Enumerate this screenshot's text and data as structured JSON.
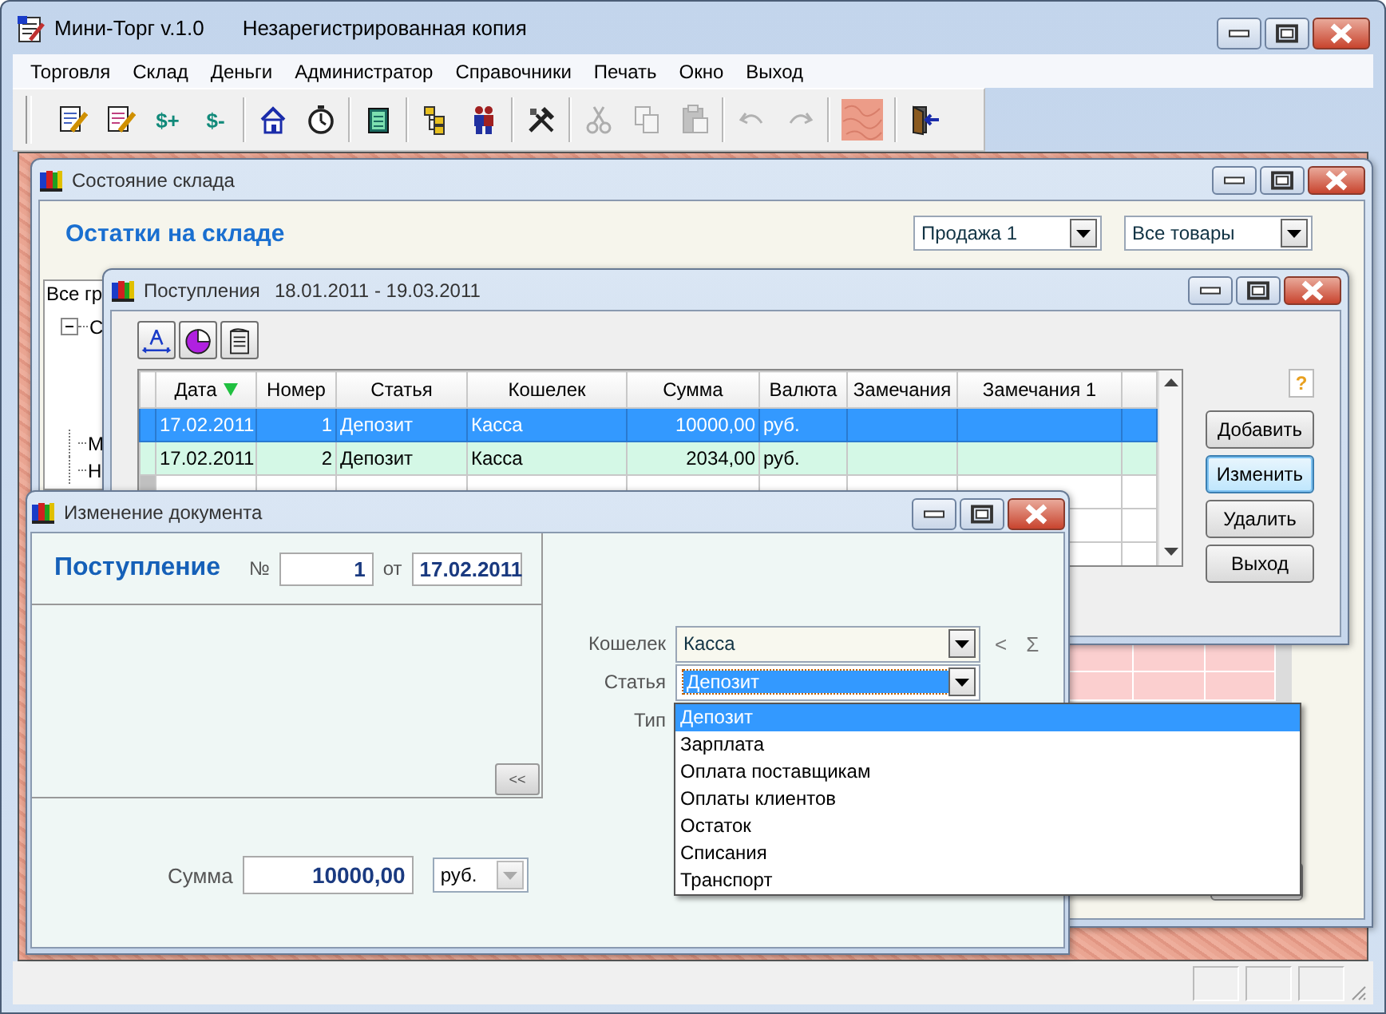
{
  "window": {
    "title": "Мини-Торг v.1.0",
    "subtitle": "Незарегистрированная копия"
  },
  "menu": [
    "Торговля",
    "Склад",
    "Деньги",
    "Администратор",
    "Справочники",
    "Печать",
    "Окно",
    "Выход"
  ],
  "toolbar": [
    [
      {
        "kind": "icon",
        "disabled": false
      },
      {
        "kind": "icon",
        "disabled": false
      },
      {
        "kind": "text",
        "text": "$+",
        "disabled": false
      },
      {
        "kind": "text",
        "text": "$-",
        "disabled": false
      }
    ],
    [
      {
        "kind": "icon",
        "disabled": false
      },
      {
        "kind": "icon",
        "disabled": false
      }
    ],
    [
      {
        "kind": "icon",
        "disabled": false
      }
    ],
    [
      {
        "kind": "icon",
        "disabled": false
      },
      {
        "kind": "icon",
        "disabled": false
      }
    ],
    [
      {
        "kind": "icon",
        "disabled": false
      }
    ],
    [
      {
        "kind": "icon",
        "disabled": true
      },
      {
        "kind": "icon",
        "disabled": true
      },
      {
        "kind": "icon",
        "disabled": true
      }
    ],
    [
      {
        "kind": "icon",
        "disabled": true
      },
      {
        "kind": "icon",
        "disabled": true
      }
    ],
    [
      {
        "kind": "icon",
        "disabled": false
      }
    ],
    [
      {
        "kind": "icon",
        "disabled": false
      }
    ]
  ],
  "stock_window": {
    "title": "Состояние склада",
    "heading": "Остатки на складе",
    "filters": [
      "Продажа 1",
      "Все товары"
    ],
    "tree": {
      "header": "Все гр",
      "items": [
        {
          "label": "С",
          "expanded": true
        },
        {
          "label": "М"
        },
        {
          "label": "Н"
        }
      ]
    }
  },
  "receipts_window": {
    "title": "Поступления",
    "period": "18.01.2011  -  19.03.2011",
    "columns": [
      {
        "label": "Дата",
        "sorted": true
      },
      {
        "label": "Номер",
        "sorted": false
      },
      {
        "label": "Статья",
        "sorted": false
      },
      {
        "label": "Кошелек",
        "sorted": false
      },
      {
        "label": "Сумма",
        "sorted": false
      },
      {
        "label": "Валюта",
        "sorted": false
      },
      {
        "label": "Замечания",
        "sorted": false
      },
      {
        "label": "Замечания 1",
        "sorted": false
      }
    ],
    "rows": [
      {
        "selected": true,
        "cells": [
          "17.02.2011",
          "1",
          "Депозит",
          "Касса",
          "10000,00",
          "руб.",
          "",
          ""
        ]
      },
      {
        "selected": false,
        "cells": [
          "17.02.2011",
          "2",
          "Депозит",
          "Касса",
          "2034,00",
          "руб.",
          "",
          ""
        ]
      }
    ],
    "help_button": "?",
    "buttons": [
      {
        "label": "Добавить",
        "focused": false
      },
      {
        "label": "Изменить",
        "focused": true
      },
      {
        "label": "Удалить",
        "focused": false
      },
      {
        "label": "Выход",
        "focused": false
      }
    ]
  },
  "edit_dialog": {
    "title": "Изменение документа",
    "heading": "Поступление",
    "number_label": "№",
    "number": "1",
    "date_label": "от",
    "date": "17.02.2011",
    "collapse_button": "<<",
    "fields": [
      {
        "label": "Кошелек",
        "value": "Касса",
        "focused": false
      },
      {
        "label": "Статья",
        "value": "Депозит",
        "focused": true
      },
      {
        "label": "Тип"
      }
    ],
    "side_buttons": [
      "<",
      "Σ"
    ],
    "sum_label": "Сумма",
    "sum": "10000,00",
    "currency": "руб.",
    "dropdown": [
      {
        "label": "Депозит",
        "selected": true
      },
      {
        "label": "Зарплата",
        "selected": false
      },
      {
        "label": "Оплата поставщикам",
        "selected": false
      },
      {
        "label": "Оплаты клиентов",
        "selected": false
      },
      {
        "label": "Остаток",
        "selected": false
      },
      {
        "label": "Списания",
        "selected": false
      },
      {
        "label": "Транспорт",
        "selected": false
      }
    ]
  }
}
